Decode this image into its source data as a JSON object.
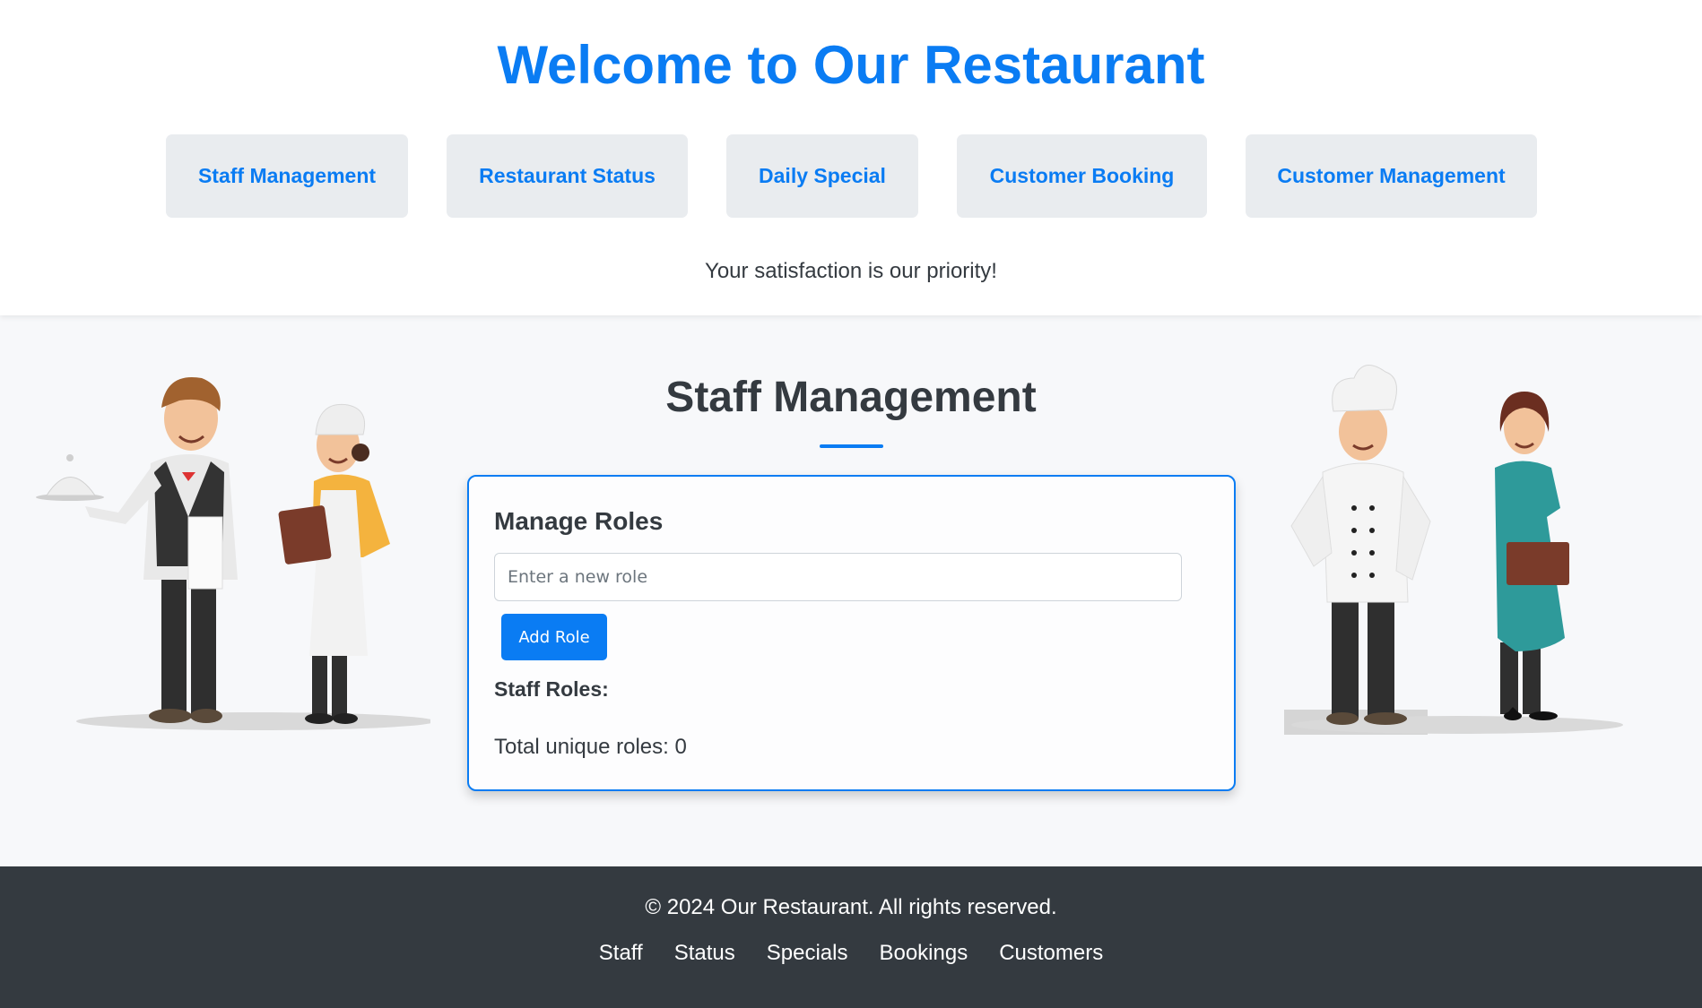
{
  "header": {
    "title": "Welcome to Our Restaurant",
    "nav": [
      {
        "label": "Staff Management"
      },
      {
        "label": "Restaurant Status"
      },
      {
        "label": "Daily Special"
      },
      {
        "label": "Customer Booking"
      },
      {
        "label": "Customer Management"
      }
    ],
    "tagline": "Your satisfaction is our priority!"
  },
  "main": {
    "title": "Staff Management",
    "card": {
      "title": "Manage Roles",
      "input_placeholder": "Enter a new role",
      "input_value": "",
      "add_button_label": "Add Role",
      "roles_label": "Staff Roles:",
      "roles": [],
      "total_label": "Total unique roles: 0"
    }
  },
  "footer": {
    "copyright": "© 2024 Our Restaurant. All rights reserved.",
    "links": [
      "Staff",
      "Status",
      "Specials",
      "Bookings",
      "Customers"
    ]
  },
  "colors": {
    "accent": "#0a7cf3",
    "nav_bg": "#e9ecef",
    "footer_bg": "#343a40",
    "text_dark": "#343a40"
  }
}
